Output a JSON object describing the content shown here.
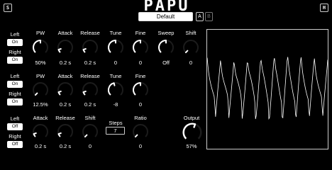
{
  "app": {
    "title": "PAPU",
    "left_corner": "S",
    "right_corner": "H",
    "preset": "Default",
    "a_label": "A",
    "b_label": "B"
  },
  "ch1": {
    "left_label": "Left",
    "left_state": "On",
    "right_label": "Right",
    "right_state": "On",
    "knobs": [
      {
        "label": "PW",
        "value": "50%",
        "level": 0.5
      },
      {
        "label": "Attack",
        "value": "0.2 s",
        "level": 0.1
      },
      {
        "label": "Release",
        "value": "0.2 s",
        "level": 0.1
      },
      {
        "label": "Tune",
        "value": "0",
        "level": 0.5
      },
      {
        "label": "Fine",
        "value": "0",
        "level": 0.5
      },
      {
        "label": "Sweep",
        "value": "Off",
        "level": 0.5
      },
      {
        "label": "Shift",
        "value": "0",
        "level": 0.0
      }
    ]
  },
  "ch2": {
    "left_label": "Left",
    "left_state": "On",
    "right_label": "Right",
    "right_state": "On",
    "knobs": [
      {
        "label": "PW",
        "value": "12.5%",
        "level": 0.0
      },
      {
        "label": "Attack",
        "value": "0.2 s",
        "level": 0.1
      },
      {
        "label": "Release",
        "value": "0.2 s",
        "level": 0.1
      },
      {
        "label": "Tune",
        "value": "-8",
        "level": 0.45
      },
      {
        "label": "Fine",
        "value": "0",
        "level": 0.5
      }
    ]
  },
  "ch3": {
    "left_label": "Left",
    "left_state": "Off",
    "right_label": "Right",
    "right_state": "Off",
    "knobs": [
      {
        "label": "Attack",
        "value": "0.2 s",
        "level": 0.1
      },
      {
        "label": "Release",
        "value": "0.2 s",
        "level": 0.1
      },
      {
        "label": "Shift",
        "value": "0",
        "level": 0.0
      },
      {
        "label": "Ratio",
        "value": "0",
        "level": 0.0
      }
    ],
    "steps_label": "Steps",
    "steps_value": "7"
  },
  "output": {
    "label": "Output",
    "value": "57%",
    "level": 0.57
  }
}
